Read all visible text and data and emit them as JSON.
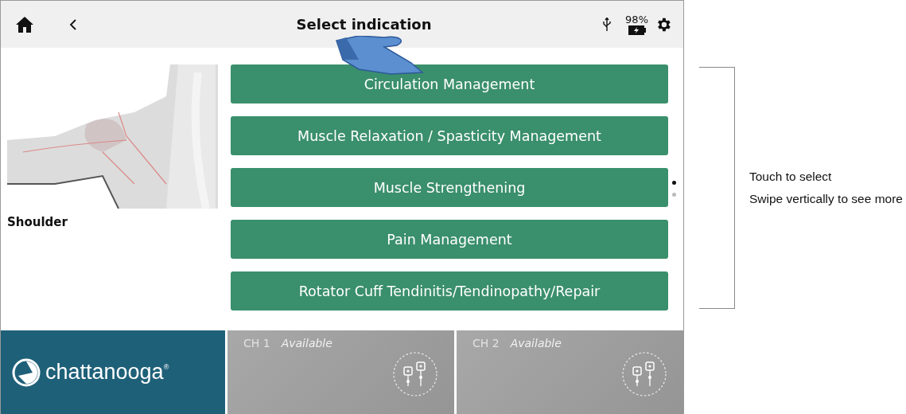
{
  "header": {
    "title": "Select indication",
    "battery": "98%"
  },
  "region": {
    "label": "Shoulder"
  },
  "indications": [
    "Circulation Management",
    "Muscle Relaxation / Spasticity Management",
    "Muscle Strengthening",
    "Pain Management",
    "Rotator Cuff Tendinitis/Tendinopathy/Repair"
  ],
  "pager": [
    {
      "selected": true
    },
    {
      "selected": false
    }
  ],
  "brand": "chattanooga$^{®}$",
  "channels": [
    {
      "label": "CH 1",
      "status": "Available"
    },
    {
      "label": "CH 2",
      "status": "Available"
    }
  ],
  "hint": [
    "Touch to select",
    "Swipe vertically to see more"
  ]
}
